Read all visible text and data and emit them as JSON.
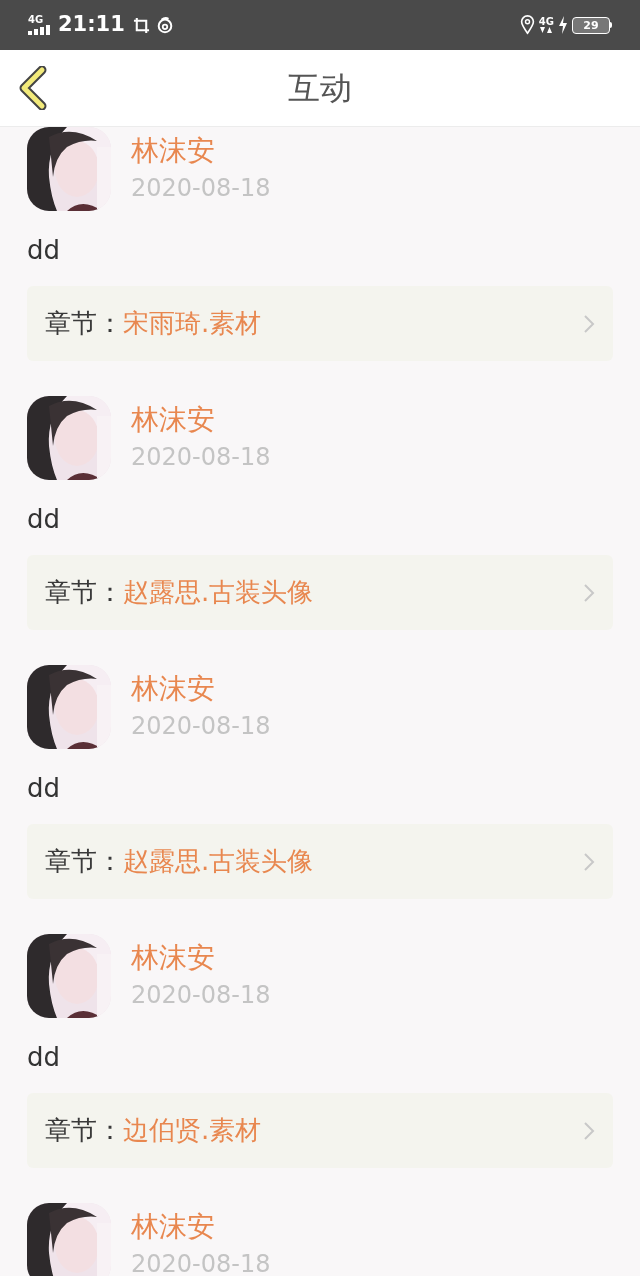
{
  "status_bar": {
    "network_left": "4G",
    "time": "21:11",
    "network_right": "4G",
    "battery": "29"
  },
  "header": {
    "title": "互动"
  },
  "comments": [
    {
      "name": "林沫安",
      "date": "2020-08-18",
      "text": "dd",
      "chapter_label": "章节：",
      "chapter": "宋雨琦.素材"
    },
    {
      "name": "林沫安",
      "date": "2020-08-18",
      "text": "dd",
      "chapter_label": "章节：",
      "chapter": "赵露思.古装头像"
    },
    {
      "name": "林沫安",
      "date": "2020-08-18",
      "text": "dd",
      "chapter_label": "章节：",
      "chapter": "赵露思.古装头像"
    },
    {
      "name": "林沫安",
      "date": "2020-08-18",
      "text": "dd",
      "chapter_label": "章节：",
      "chapter": "边伯贤.素材"
    },
    {
      "name": "林沫安",
      "date": "2020-08-18"
    }
  ]
}
